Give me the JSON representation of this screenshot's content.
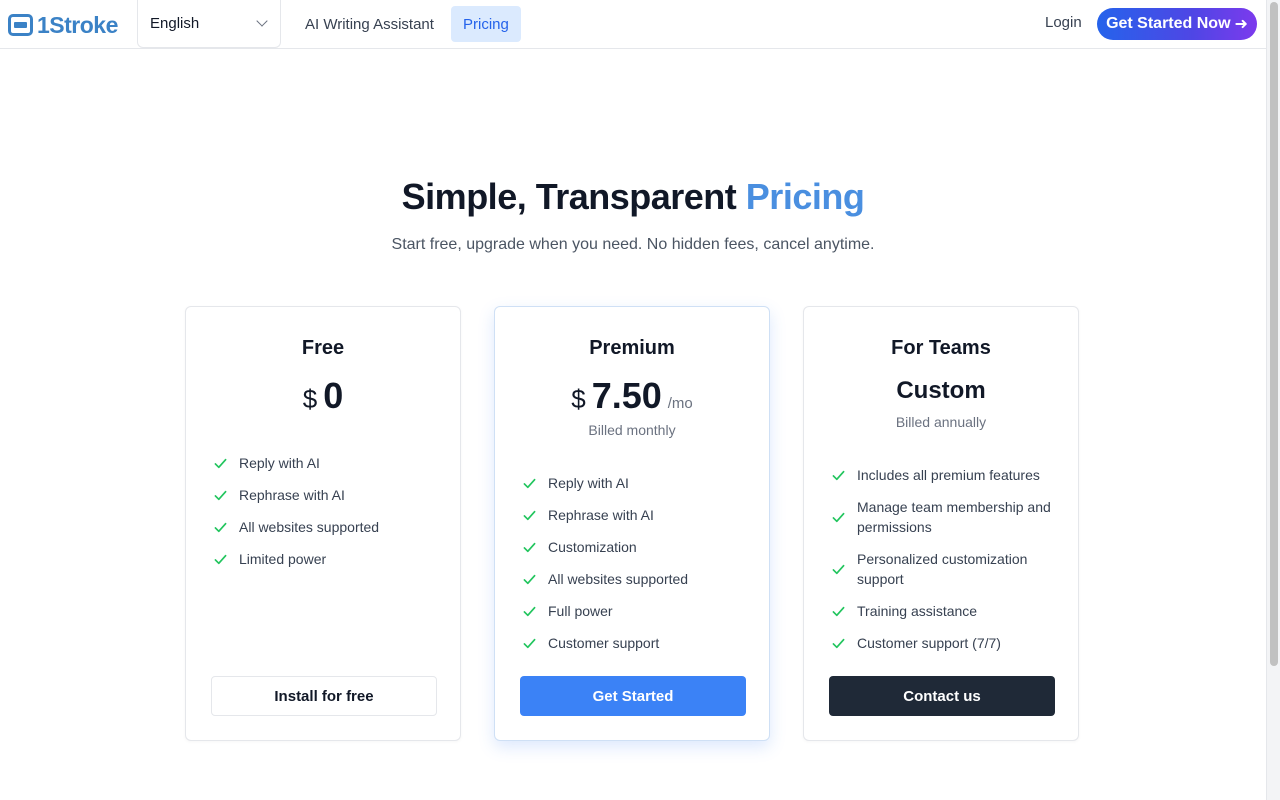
{
  "header": {
    "logo_text": "1Stroke",
    "language": "English",
    "nav": [
      {
        "label": "AI Writing Assistant"
      },
      {
        "label": "Pricing"
      }
    ],
    "login": "Login",
    "cta": "Get Started Now",
    "cta_icon": "arrow-right-icon"
  },
  "hero": {
    "title_main": "Simple, Transparent ",
    "title_accent": "Pricing",
    "subtitle": "Start free, upgrade when you need. No hidden fees, cancel anytime."
  },
  "plans": [
    {
      "name": "Free",
      "currency": "$",
      "price": "0",
      "features": [
        "Reply with AI",
        "Rephrase with AI",
        "All websites supported",
        "Limited power"
      ],
      "button": "Install for free"
    },
    {
      "name": "Premium",
      "currency": "$",
      "price": "7.50",
      "period": "/mo",
      "billing": "Billed monthly",
      "features": [
        "Reply with AI",
        "Rephrase with AI",
        "Customization",
        "All websites supported",
        "Full power",
        "Customer support"
      ],
      "button": "Get Started"
    },
    {
      "name": "For Teams",
      "price": "Custom",
      "billing": "Billed annually",
      "features": [
        "Includes all premium features",
        "Manage team membership and permissions",
        "Personalized customization support",
        "Training assistance",
        "Customer support (7/7)"
      ],
      "button": "Contact us"
    }
  ],
  "colors": {
    "brand": "#3b82c6",
    "accent_blue": "#3b82f6",
    "check_green": "#22c55e",
    "dark_button": "#1f2937"
  }
}
